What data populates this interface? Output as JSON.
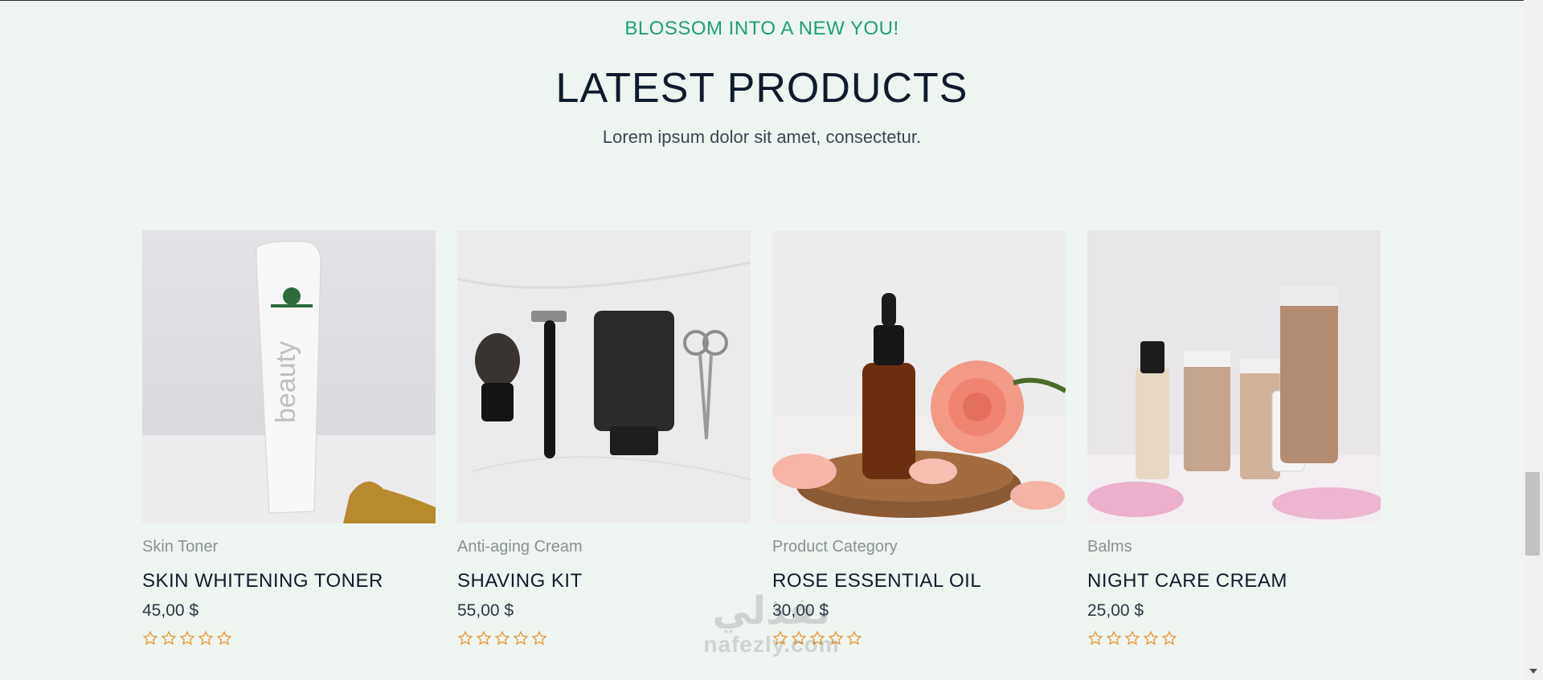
{
  "section": {
    "tagline": "BLOSSOM INTO A NEW YOU!",
    "title": "LATEST PRODUCTS",
    "subtitle": "Lorem ipsum dolor sit amet, consectetur."
  },
  "products": [
    {
      "category": "Skin Toner",
      "title": "SKIN WHITENING TONER",
      "price": "45,00 $",
      "rating": 0,
      "max_rating": 5,
      "image": "white-beauty-tube-photo"
    },
    {
      "category": "Anti-aging Cream",
      "title": "SHAVING KIT",
      "price": "55,00 $",
      "rating": 0,
      "max_rating": 5,
      "image": "shaving-kit-photo"
    },
    {
      "category": "Product Category",
      "title": "ROSE ESSENTIAL OIL",
      "price": "30,00 $",
      "rating": 0,
      "max_rating": 5,
      "image": "rose-oil-bottle-photo"
    },
    {
      "category": "Balms",
      "title": "NIGHT CARE CREAM",
      "price": "25,00 $",
      "rating": 0,
      "max_rating": 5,
      "image": "skincare-bottles-photo"
    }
  ],
  "watermark": {
    "arabic": "نفذلي",
    "latin": "nafezly.com"
  },
  "colors": {
    "accent": "#1f9e7c",
    "star": "#e8963a",
    "background": "#eef5f0",
    "heading": "#0f1b2d"
  }
}
